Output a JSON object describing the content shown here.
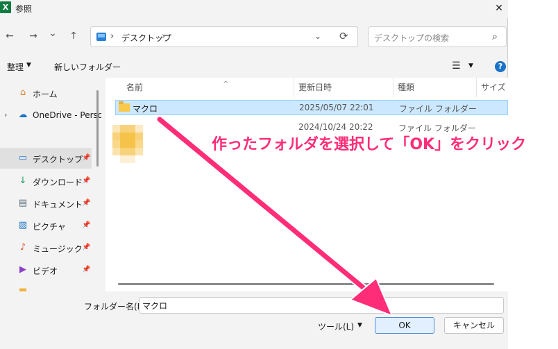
{
  "window": {
    "title": "参照",
    "app_icon": "excel-icon",
    "close_glyph": "✕"
  },
  "nav": {
    "back_glyph": "←",
    "forward_glyph": "→",
    "recent_glyph": "⌄",
    "up_glyph": "↑",
    "address": {
      "separator": "›",
      "location": "デスクトップ",
      "dropdown_glyph": "⌄",
      "refresh_glyph": "⟳"
    },
    "search": {
      "placeholder": "デスクトップの検索",
      "icon_glyph": "⌕"
    }
  },
  "toolbar": {
    "organize_label": "整理",
    "dropdown_glyph": "▼",
    "new_folder_label": "新しいフォルダー",
    "view_glyph": "☰",
    "help_glyph": "?"
  },
  "sidebar": {
    "expand_glyph": "›",
    "pin_glyph": "📌",
    "items": [
      {
        "label": "ホーム",
        "icon": "home-icon",
        "glyph": "⌂"
      },
      {
        "label": "OneDrive - Perso",
        "icon": "cloud-icon",
        "glyph": "☁"
      },
      {
        "label": "デスクトップ",
        "icon": "desktop-icon",
        "glyph": "▭"
      },
      {
        "label": "ダウンロード",
        "icon": "download-icon",
        "glyph": "↓"
      },
      {
        "label": "ドキュメント",
        "icon": "document-icon",
        "glyph": "▤"
      },
      {
        "label": "ピクチャ",
        "icon": "pictures-icon",
        "glyph": "▨"
      },
      {
        "label": "ミュージック",
        "icon": "music-icon",
        "glyph": "♪"
      },
      {
        "label": "ビデオ",
        "icon": "video-icon",
        "glyph": "▶"
      }
    ]
  },
  "columns": {
    "name": "名前",
    "date": "更新日時",
    "type": "種類",
    "size": "サイズ",
    "sort_glyph": "^"
  },
  "files": [
    {
      "name": "マクロ",
      "date": "2025/05/07 22:01",
      "type": "ファイル フォルダー"
    },
    {
      "name": "",
      "date": "2024/10/24 20:22",
      "type": "ファイル フォルダー"
    }
  ],
  "footer": {
    "folder_name_label": "フォルダー名(N):",
    "folder_name_value": "マクロ",
    "tools_label": "ツール(L)",
    "tools_arrow": "▼",
    "ok_label": "OK",
    "cancel_label": "キャンセル"
  },
  "annotation": {
    "text": "作ったフォルダを選択して「OK」をクリック",
    "color": "#ff2d78"
  }
}
